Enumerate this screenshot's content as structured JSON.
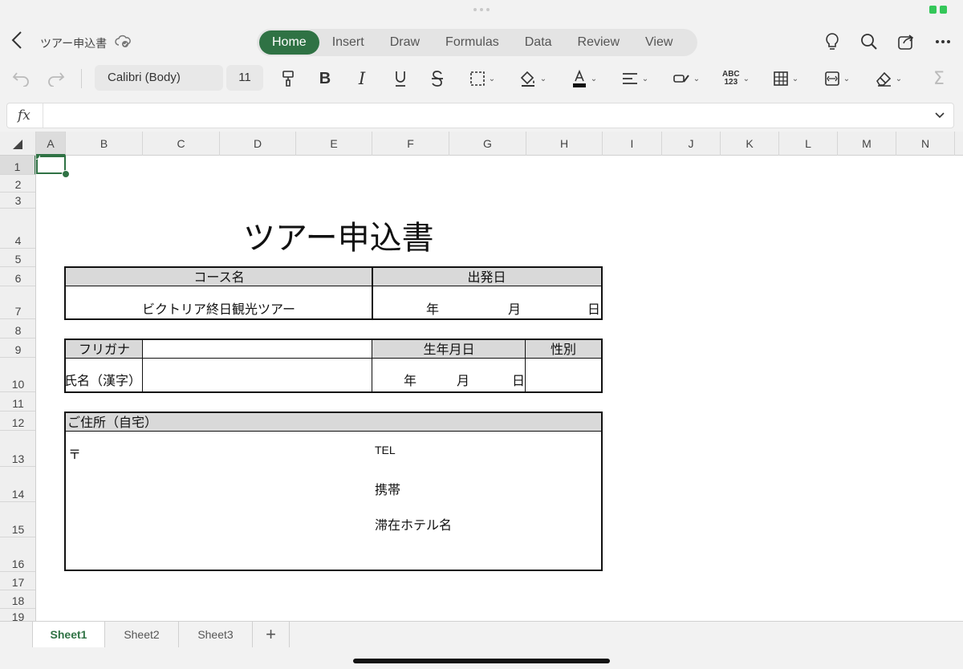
{
  "doc": {
    "title": "ツアー申込書"
  },
  "ribbon_tabs": [
    {
      "label": "Home",
      "active": true
    },
    {
      "label": "Insert",
      "active": false
    },
    {
      "label": "Draw",
      "active": false
    },
    {
      "label": "Formulas",
      "active": false
    },
    {
      "label": "Data",
      "active": false
    },
    {
      "label": "Review",
      "active": false
    },
    {
      "label": "View",
      "active": false
    }
  ],
  "toolbar": {
    "font_name": "Calibri (Body)",
    "font_size": "11",
    "number_format_label": "ABC\n123"
  },
  "formula_bar": {
    "fx_label": "fx",
    "value": ""
  },
  "columns": [
    "A",
    "B",
    "C",
    "D",
    "E",
    "F",
    "G",
    "H",
    "I",
    "J",
    "K",
    "L",
    "M",
    "N"
  ],
  "rows": [
    "1",
    "2",
    "3",
    "4",
    "5",
    "6",
    "7",
    "8",
    "9",
    "10",
    "11",
    "12",
    "13",
    "14",
    "15",
    "16",
    "17",
    "18",
    "19"
  ],
  "selected_cell": "A1",
  "form": {
    "title": "ツアー申込書",
    "course_header": "コース名",
    "departure_header": "出発日",
    "course_value": "ビクトリア終日観光ツアー",
    "dep_year": "年",
    "dep_month": "月",
    "dep_day": "日",
    "furigana_label": "フリガナ",
    "birthdate_header": "生年月日",
    "gender_header": "性別",
    "name_label": "氏名（漢字）",
    "birth_year": "年",
    "birth_month": "月",
    "birth_day": "日",
    "address_header": "ご住所（自宅）",
    "postal_mark": "〒",
    "tel_label": "TEL",
    "mobile_label": "携帯",
    "hotel_label": "滞在ホテル名"
  },
  "sheets": [
    {
      "label": "Sheet1",
      "active": true
    },
    {
      "label": "Sheet2",
      "active": false
    },
    {
      "label": "Sheet3",
      "active": false
    }
  ],
  "add_sheet_label": "+",
  "colors": {
    "accent": "#2f7244",
    "header_fill": "#d9d9d9"
  }
}
